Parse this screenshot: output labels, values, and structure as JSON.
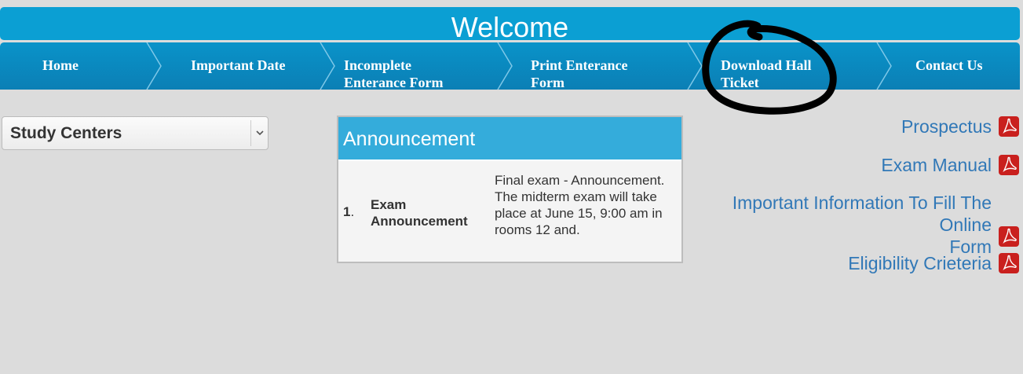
{
  "header": {
    "title": "Welcome"
  },
  "nav": {
    "items": [
      {
        "label": "Home"
      },
      {
        "label": "Important Date"
      },
      {
        "label_line1": "Incomplete",
        "label_line2": "Enterance Form"
      },
      {
        "label_line1": "Print Enterance",
        "label_line2": "Form"
      },
      {
        "label_line1": "Download Hall",
        "label_line2": "Ticket"
      },
      {
        "label": "Contact Us"
      }
    ]
  },
  "study_centers": {
    "selected": "Study Centers"
  },
  "announcement": {
    "heading": "Announcement",
    "rows": [
      {
        "number": "1",
        "dot": ".",
        "title_line1": "Exam",
        "title_line2": "Announcement",
        "description": "Final exam - Announcement. The midterm exam will take place at June 15, 9:00 am in rooms 12 and."
      }
    ]
  },
  "links": [
    {
      "label": "Prospectus",
      "icon": "pdf-icon"
    },
    {
      "label": "Exam Manual",
      "icon": "pdf-icon"
    },
    {
      "label_line1": "Important Information To Fill The Online",
      "label_line2": "Form",
      "icon": "pdf-icon"
    },
    {
      "label": "Eligibility Crieteria",
      "icon": "pdf-icon"
    }
  ],
  "colors": {
    "background": "#dcdcdc",
    "header": "#0b9fd3",
    "nav": "#0b7fb5",
    "announcement_head": "#34acdb",
    "link": "#3178b7",
    "pdf_red": "#c9201e"
  }
}
